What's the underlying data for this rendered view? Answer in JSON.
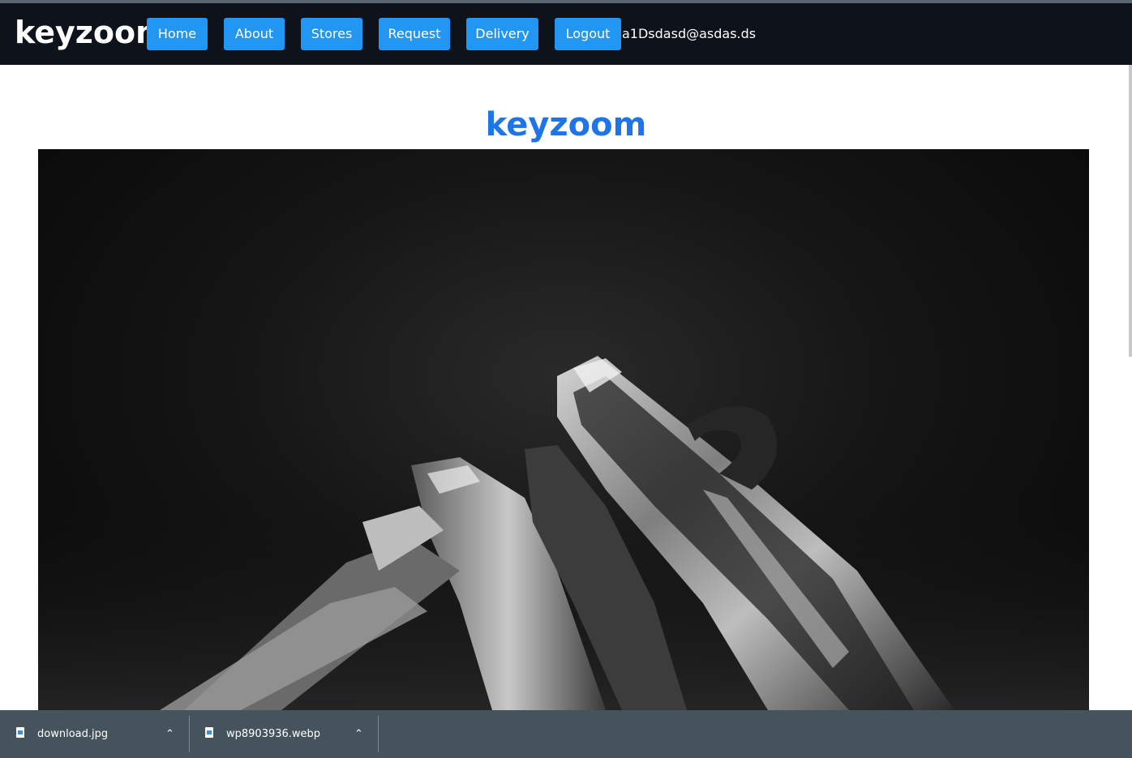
{
  "navbar": {
    "brand": "keyzoom",
    "items": [
      {
        "label": "Home"
      },
      {
        "label": "About"
      },
      {
        "label": "Stores"
      },
      {
        "label": "Request"
      },
      {
        "label": "Delivery"
      },
      {
        "label": "Logout"
      }
    ],
    "user_email": "a1Dsdasd@asdas.ds"
  },
  "main": {
    "title": "keyzoom",
    "hero_image": "keys-photo"
  },
  "downloads": [
    {
      "name": "download.jpg",
      "icon": "file-icon"
    },
    {
      "name": "wp8903936.webp",
      "icon": "file-icon"
    }
  ],
  "colors": {
    "navbar_bg": "#0e121a",
    "button_bg": "#2196f3",
    "title": "#1e74e8",
    "download_bar": "#45535d"
  }
}
